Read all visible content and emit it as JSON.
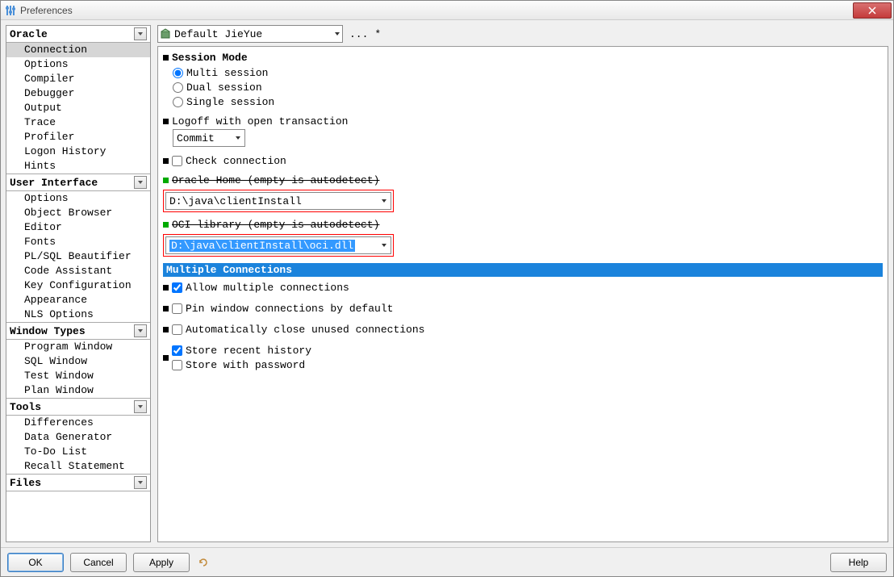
{
  "window": {
    "title": "Preferences"
  },
  "sidebar": {
    "categories": [
      {
        "label": "Oracle",
        "items": [
          "Connection",
          "Options",
          "Compiler",
          "Debugger",
          "Output",
          "Trace",
          "Profiler",
          "Logon History",
          "Hints"
        ],
        "selected": 0
      },
      {
        "label": "User Interface",
        "items": [
          "Options",
          "Object Browser",
          "Editor",
          "Fonts",
          "PL/SQL Beautifier",
          "Code Assistant",
          "Key Configuration",
          "Appearance",
          "NLS Options"
        ]
      },
      {
        "label": "Window Types",
        "items": [
          "Program Window",
          "SQL Window",
          "Test Window",
          "Plan Window"
        ]
      },
      {
        "label": "Tools",
        "items": [
          "Differences",
          "Data Generator",
          "To-Do List",
          "Recall Statement"
        ]
      },
      {
        "label": "Files",
        "items": []
      }
    ]
  },
  "preset": {
    "value": "Default JieYue",
    "suffix": "*"
  },
  "session": {
    "label": "Session Mode",
    "options": [
      "Multi session",
      "Dual session",
      "Single session"
    ],
    "selected": 0
  },
  "logoff": {
    "label": "Logoff with open transaction",
    "value": "Commit"
  },
  "checkConn": {
    "label": "Check connection",
    "checked": false
  },
  "oracleHome": {
    "label": "Oracle Home (empty is autodetect)",
    "value": "D:\\java\\clientInstall"
  },
  "ociLib": {
    "label": "OCI library (empty is autodetect)",
    "value": "D:\\java\\clientInstall\\oci.dll"
  },
  "multiConn": {
    "header": "Multiple Connections",
    "allow": {
      "label": "Allow multiple connections",
      "checked": true
    },
    "pin": {
      "label": "Pin window connections by default",
      "checked": false
    },
    "autoClose": {
      "label": "Automatically close unused connections",
      "checked": false
    },
    "storeHist": {
      "label": "Store recent history",
      "checked": true
    },
    "storePwd": {
      "label": "Store with password",
      "checked": false
    }
  },
  "buttons": {
    "ok": "OK",
    "cancel": "Cancel",
    "apply": "Apply",
    "help": "Help",
    "ellipsis": "...",
    "dots_label": "..."
  }
}
